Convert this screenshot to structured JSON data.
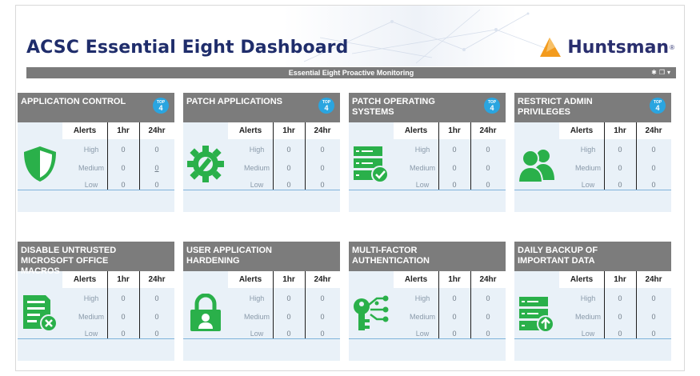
{
  "page": {
    "title": "ACSC Essential Eight Dashboard",
    "brand": "Huntsman",
    "brand_mark": "®"
  },
  "bar": {
    "title": "Essential Eight Proactive Monitoring"
  },
  "columns": {
    "alerts": "Alerts",
    "h1": "1hr",
    "h24": "24hr"
  },
  "rows": [
    "High",
    "Medium",
    "Low"
  ],
  "badge": {
    "top": "TOP",
    "num": "4"
  },
  "colors": {
    "accent_green": "#2ab04a",
    "badge_blue": "#2aa5e0",
    "header_gray": "#7c7c7c"
  },
  "cards": [
    {
      "title": "Application Control",
      "icon": "shield-icon",
      "top4": true,
      "values": [
        [
          "0",
          "0"
        ],
        [
          "0",
          "0"
        ],
        [
          "0",
          "0"
        ]
      ]
    },
    {
      "title": "Patch Applications",
      "icon": "gear-wrench-icon",
      "top4": true,
      "values": [
        [
          "0",
          "0"
        ],
        [
          "0",
          "0"
        ],
        [
          "0",
          "0"
        ]
      ]
    },
    {
      "title": "Patch Operating Systems",
      "icon": "server-check-icon",
      "top4": true,
      "values": [
        [
          "0",
          "0"
        ],
        [
          "0",
          "0"
        ],
        [
          "0",
          "0"
        ]
      ]
    },
    {
      "title": "Restrict Admin Privileges",
      "icon": "users-icon",
      "top4": true,
      "values": [
        [
          "0",
          "0"
        ],
        [
          "0",
          "0"
        ],
        [
          "0",
          "0"
        ]
      ]
    },
    {
      "title": "Disable Untrusted Microsoft Office Macros",
      "icon": "document-x-icon",
      "top4": false,
      "values": [
        [
          "0",
          "0"
        ],
        [
          "0",
          "0"
        ],
        [
          "0",
          "0"
        ]
      ]
    },
    {
      "title": "User Application Hardening",
      "icon": "lock-user-icon",
      "top4": false,
      "values": [
        [
          "0",
          "0"
        ],
        [
          "0",
          "0"
        ],
        [
          "0",
          "0"
        ]
      ]
    },
    {
      "title": "Multi-Factor Authentication",
      "icon": "key-network-icon",
      "top4": false,
      "values": [
        [
          "0",
          "0"
        ],
        [
          "0",
          "0"
        ],
        [
          "0",
          "0"
        ]
      ]
    },
    {
      "title": "Daily Backup of Important Data",
      "icon": "server-upload-icon",
      "top4": false,
      "values": [
        [
          "0",
          "0"
        ],
        [
          "0",
          "0"
        ],
        [
          "0",
          "0"
        ]
      ]
    }
  ]
}
